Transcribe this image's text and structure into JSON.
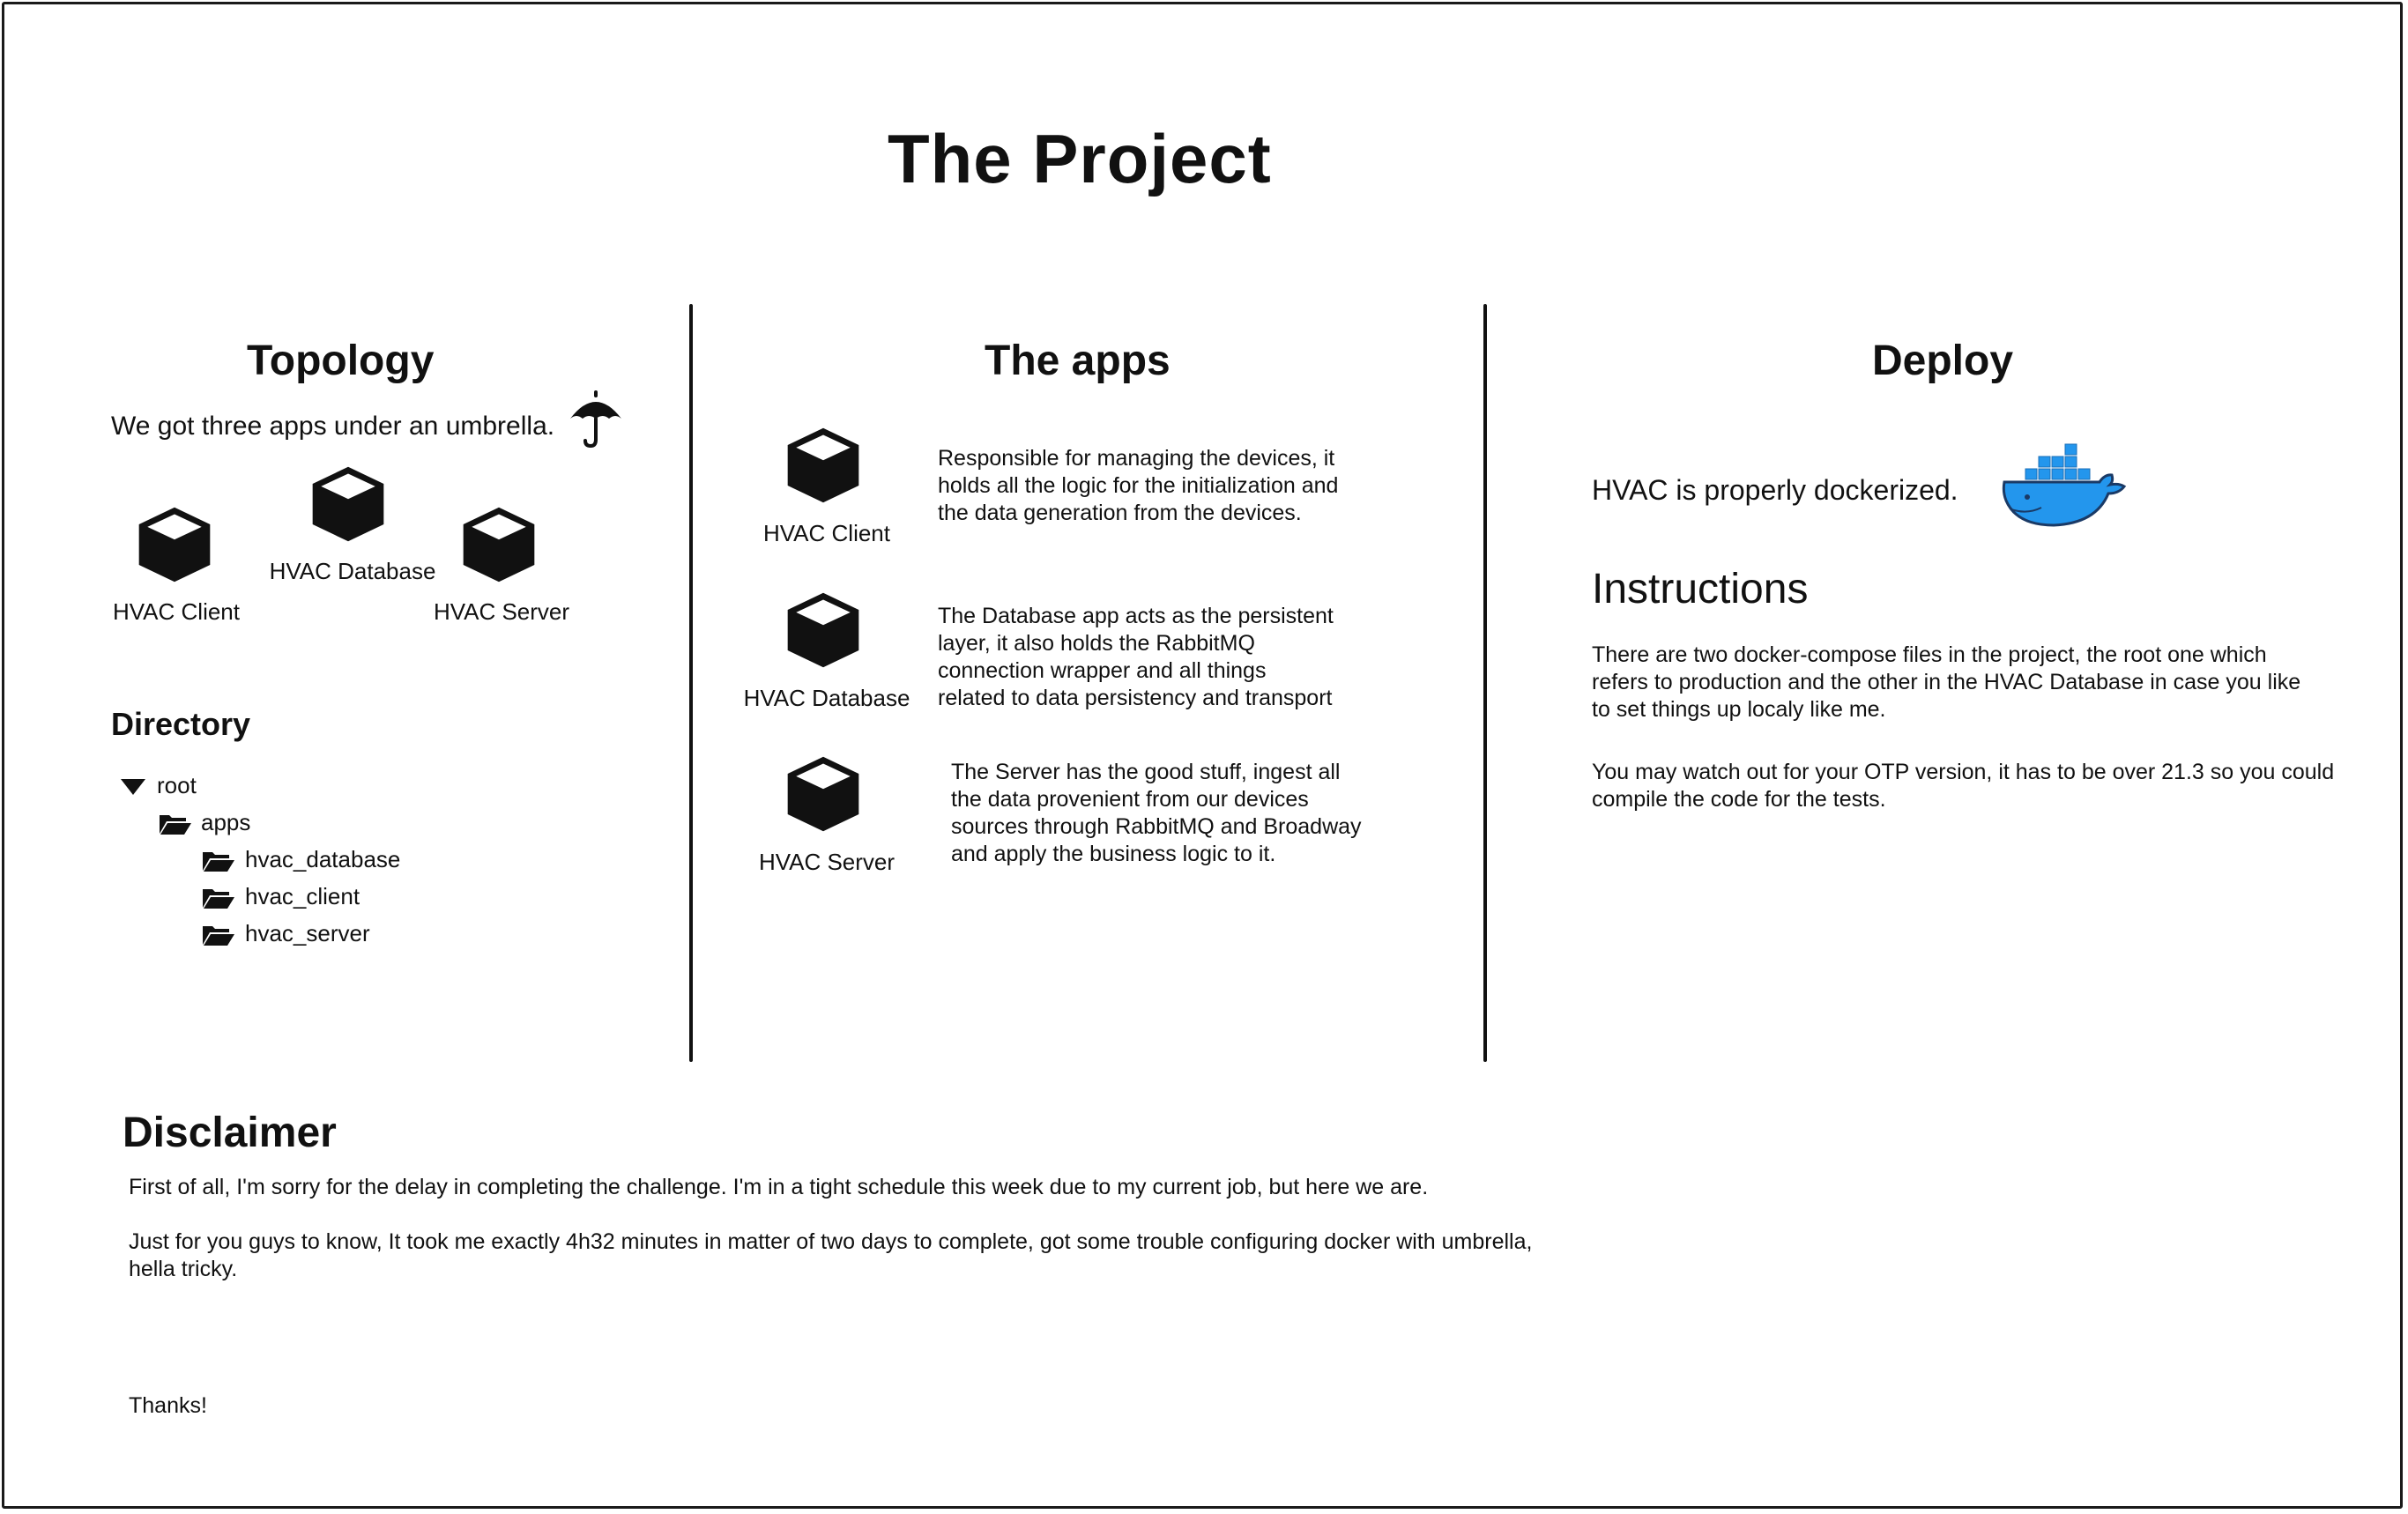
{
  "page": {
    "title": "The Project"
  },
  "topology": {
    "heading": "Topology",
    "intro": "We got three apps under an umbrella.",
    "umbrella_icon": "umbrella-icon",
    "apps": [
      {
        "label": "HVAC Client"
      },
      {
        "label": "HVAC Database"
      },
      {
        "label": "HVAC Server"
      }
    ]
  },
  "directory": {
    "heading": "Directory",
    "items": [
      {
        "label": "root",
        "icon": "triangle-down-icon"
      },
      {
        "label": "apps",
        "icon": "folder-open-icon"
      },
      {
        "label": "hvac_database",
        "icon": "folder-open-icon"
      },
      {
        "label": "hvac_client",
        "icon": "folder-open-icon"
      },
      {
        "label": "hvac_server",
        "icon": "folder-open-icon"
      }
    ]
  },
  "apps": {
    "heading": "The apps",
    "items": [
      {
        "label": "HVAC Client",
        "description": [
          "Responsible for managing the devices, it",
          "holds all the logic for the initialization and",
          "the data generation from the devices."
        ]
      },
      {
        "label": "HVAC Database",
        "description": [
          "The Database app acts as the persistent",
          "layer, it also holds the RabbitMQ",
          "connection wrapper and all things",
          "related to data persistency and transport"
        ]
      },
      {
        "label": "HVAC Server",
        "description": [
          "The Server has the good stuff, ingest all",
          "the data provenient from our devices",
          "sources through RabbitMQ and Broadway",
          "and apply the business logic to it."
        ]
      }
    ]
  },
  "deploy": {
    "heading": "Deploy",
    "intro": "HVAC is properly dockerized.",
    "docker_icon": "docker-whale-icon",
    "docker_color": "#2396ed",
    "instructions_heading": "Instructions",
    "paragraph1": [
      "There are two docker-compose files in the project, the root one which",
      "refers to production and the other in the HVAC Database in case you like",
      "to set things up localy like me."
    ],
    "paragraph2": [
      "You may watch out for your OTP version, it has to be over 21.3 so you could",
      "compile the code for the tests."
    ]
  },
  "disclaimer": {
    "heading": "Disclaimer",
    "line1": "First of all, I'm sorry for the delay in completing the challenge. I'm in a tight schedule this week due to my current job, but here we are.",
    "line2a": "Just for you guys to know, It took me exactly 4h32 minutes in matter of two days to complete, got some trouble configuring docker with umbrella,",
    "line2b": "hella tricky.",
    "thanks": "Thanks!"
  }
}
